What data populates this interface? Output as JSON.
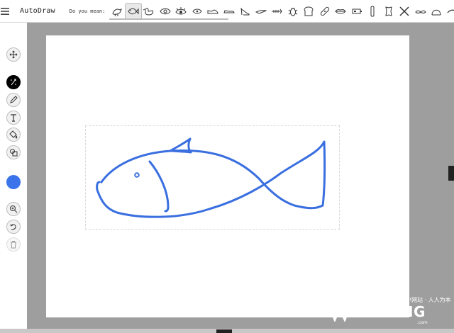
{
  "app": {
    "title": "AutoDraw"
  },
  "suggestions": {
    "label": "Do you mean:",
    "icons": [
      "bird-icon",
      "fish-icon",
      "duck-icon",
      "eye-icon",
      "eye-outline-icon",
      "eye-closed-icon",
      "shoe-icon",
      "sneaker-icon",
      "high-heel-icon",
      "bird-flying-icon",
      "fish-bone-icon",
      "bug-icon",
      "bread-icon",
      "bandage-icon",
      "lips-icon",
      "battery-icon",
      "glasses-icon",
      "bone-icon",
      "scissors-icon",
      "mustache-icon",
      "hat-icon",
      "eyebrow-icon",
      "arrow-icon"
    ],
    "selected": "fish-icon"
  },
  "tools": [
    "move-icon",
    "autodraw-icon",
    "pencil-icon",
    "text-icon",
    "fill-icon",
    "shape-icon",
    "zoom-icon",
    "undo-icon",
    "delete-icon"
  ],
  "colors": {
    "current": "#3b73ea",
    "stroke": "#3a6fe0",
    "canvas": "#ffffff",
    "background": "#9e9e9e"
  },
  "watermark": {
    "top": "国内领先设计类门户网站 · 人人为本",
    "main": "CGWANG",
    "sub": ".com"
  }
}
